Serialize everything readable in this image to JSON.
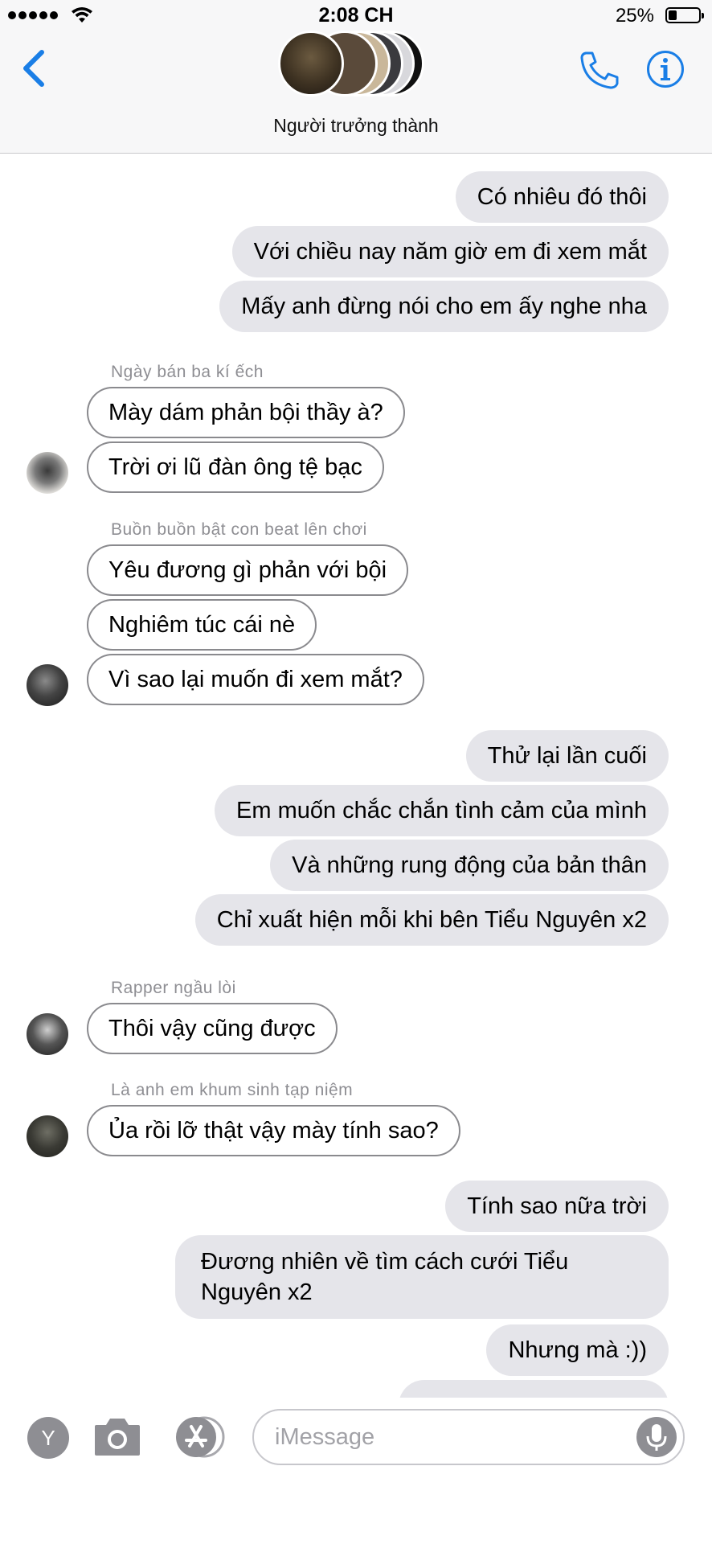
{
  "status": {
    "time": "2:08 CH",
    "battery": "25%"
  },
  "header": {
    "group_name": "Người trưởng thành"
  },
  "colors": {
    "accent": "#1a7ee6",
    "outgoing_bubble": "#e5e5ea",
    "incoming_border": "#8a8a8e"
  },
  "messages": [
    {
      "type": "out",
      "text": "Có nhiêu đó thôi"
    },
    {
      "type": "out",
      "text": "Với chiều nay năm giờ em đi xem mắt"
    },
    {
      "type": "out",
      "text": "Mấy anh đừng nói cho em ấy nghe nha"
    },
    {
      "type": "sender",
      "text": "Ngày bán ba kí ếch"
    },
    {
      "type": "in",
      "text": "Mày dám phản bội thầy à?"
    },
    {
      "type": "in",
      "text": "Trời ơi lũ đàn ông tệ bạc"
    },
    {
      "type": "sender",
      "text": "Buồn buồn bật con beat lên chơi"
    },
    {
      "type": "in",
      "text": "Yêu đương gì phản với bội"
    },
    {
      "type": "in",
      "text": "Nghiêm túc cái nè"
    },
    {
      "type": "in",
      "text": "Vì sao lại muốn đi xem mắt?"
    },
    {
      "type": "out",
      "text": "Thử lại lần cuối"
    },
    {
      "type": "out",
      "text": "Em muốn chắc chắn tình cảm của mình"
    },
    {
      "type": "out",
      "text": "Và những rung động của bản thân"
    },
    {
      "type": "out",
      "text": "Chỉ xuất hiện mỗi khi bên Tiểu Nguyên x2"
    },
    {
      "type": "sender",
      "text": "Rapper ngầu lòi"
    },
    {
      "type": "in",
      "text": "Thôi vậy cũng được"
    },
    {
      "type": "sender",
      "text": "Là anh em khum sinh tạp niệm"
    },
    {
      "type": "in",
      "text": "Ủa rồi lỡ thật vậy mày tính sao?"
    },
    {
      "type": "out",
      "text": "Tính sao nữa trời"
    },
    {
      "type": "out",
      "text": "Đương nhiên về tìm cách cưới Tiểu Nguyên x2"
    },
    {
      "type": "out",
      "text": "Nhưng mà :))"
    }
  ],
  "input": {
    "placeholder": "iMessage",
    "apps_button": "Y"
  }
}
